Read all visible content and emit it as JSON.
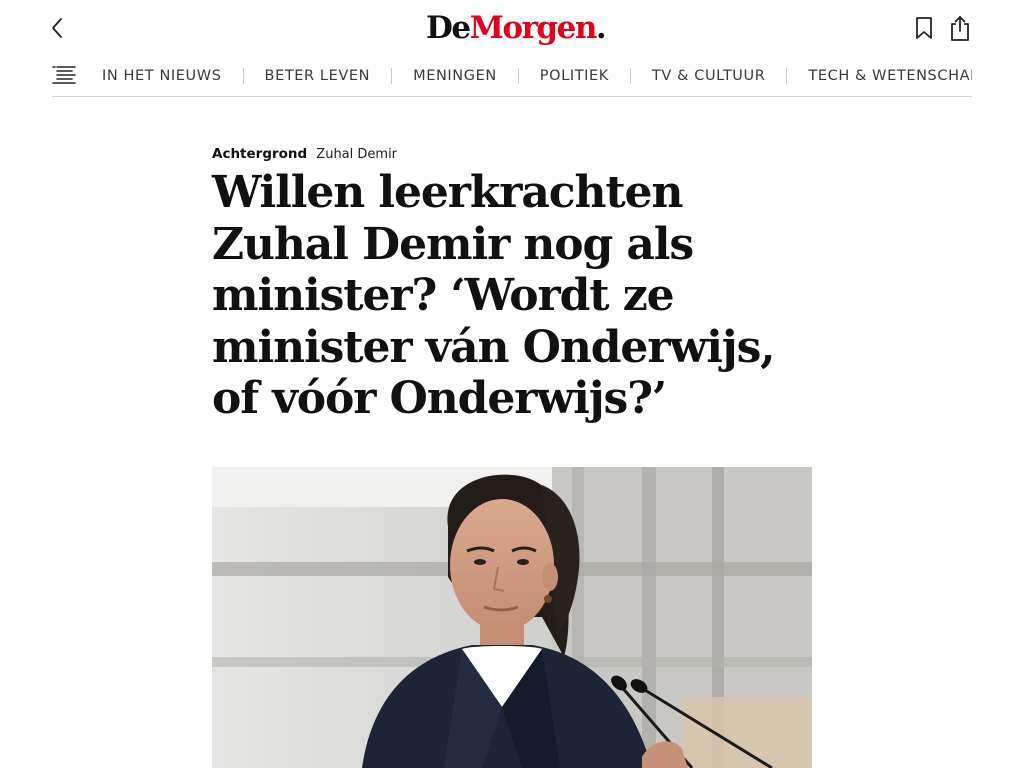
{
  "header": {
    "logo": {
      "de": "De",
      "morgen": "Morgen",
      "dot": "."
    },
    "icons": {
      "back": "chevron-left-icon",
      "bookmark": "bookmark-icon",
      "share": "share-icon"
    }
  },
  "nav": {
    "menu_icon": "menu-list-icon",
    "items": [
      {
        "label": "IN HET NIEUWS"
      },
      {
        "label": "BETER LEVEN"
      },
      {
        "label": "MENINGEN"
      },
      {
        "label": "POLITIEK"
      },
      {
        "label": "TV & CULTUUR"
      },
      {
        "label": "TECH & WETENSCHAP"
      }
    ]
  },
  "article": {
    "category": "Achtergrond",
    "tag": "Zuhal Demir",
    "headline": "Willen leerkrachten Zuhal Demir nog als minister? ‘Wordt ze minister ván Onderwijs, of vóór Onderwijs?’"
  },
  "colors": {
    "brand_red": "#e3001b",
    "text": "#111111",
    "divider": "#d6d6d6"
  }
}
